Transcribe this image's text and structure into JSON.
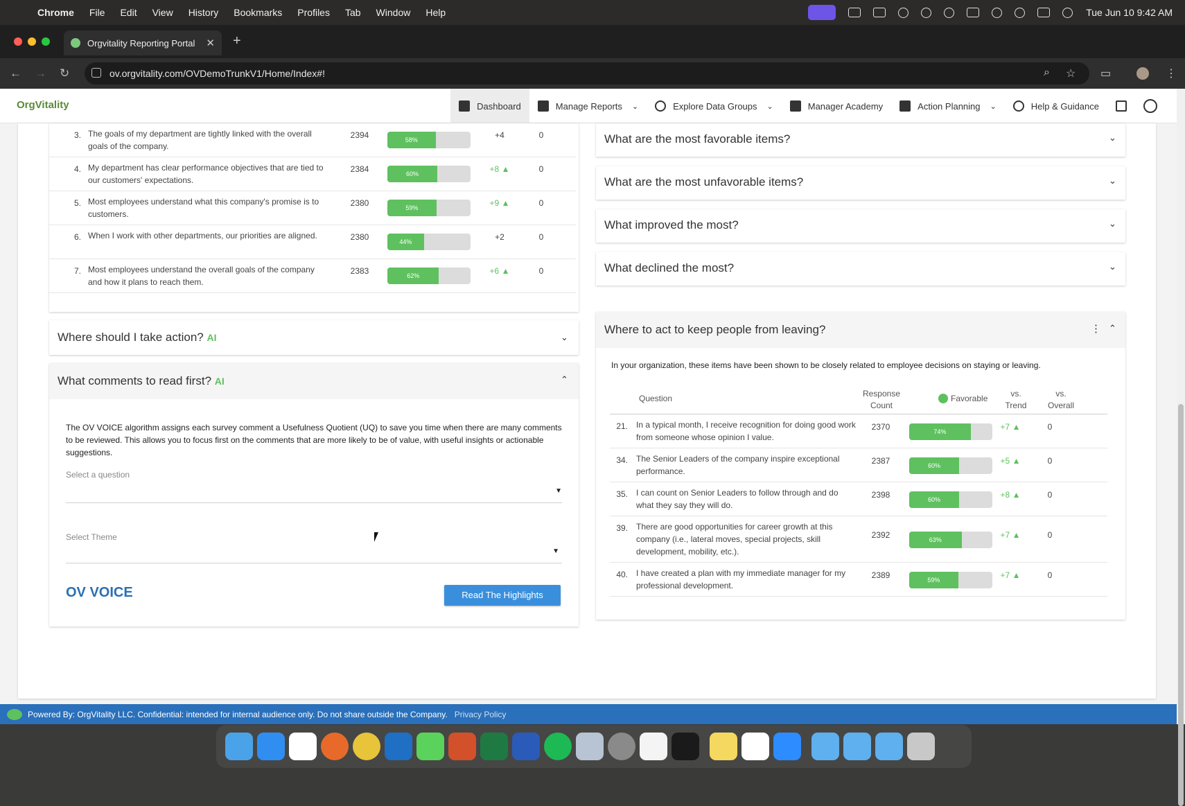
{
  "menubar": {
    "items": [
      "Chrome",
      "File",
      "Edit",
      "View",
      "History",
      "Bookmarks",
      "Profiles",
      "Tab",
      "Window",
      "Help"
    ],
    "datetime": "Tue Jun 10  9:42 AM"
  },
  "browser": {
    "tab_title": "Orgvitality Reporting Portal",
    "url": "ov.orgvitality.com/OVDemoTrunkV1/Home/Index#!"
  },
  "app": {
    "logo": "OrgVitality",
    "nav": {
      "dashboard": "Dashboard",
      "manage_reports": "Manage Reports",
      "explore_data_groups": "Explore Data Groups",
      "manager_academy": "Manager Academy",
      "action_planning": "Action Planning",
      "help_guidance": "Help & Guidance"
    }
  },
  "left_table": {
    "rows": [
      {
        "num": "3.",
        "question": "The goals of my department are tightly linked with the overall goals of the company.",
        "count": "2394",
        "favorable": 58,
        "fav_label": "58%",
        "trend": "+4",
        "trend_up": false,
        "overall": "0"
      },
      {
        "num": "4.",
        "question": "My department has clear performance objectives that are tied to our customers' expectations.",
        "count": "2384",
        "favorable": 60,
        "fav_label": "60%",
        "trend": "+8 ▲",
        "trend_up": true,
        "overall": "0"
      },
      {
        "num": "5.",
        "question": "Most employees understand what this company's promise is to customers.",
        "count": "2380",
        "favorable": 59,
        "fav_label": "59%",
        "trend": "+9 ▲",
        "trend_up": true,
        "overall": "0"
      },
      {
        "num": "6.",
        "question": "When I work with other departments, our priorities are aligned.",
        "count": "2380",
        "favorable": 44,
        "fav_label": "44%",
        "trend": "+2",
        "trend_up": false,
        "overall": "0"
      },
      {
        "num": "7.",
        "question": "Most employees understand the overall goals of the company and how it plans to reach them.",
        "count": "2383",
        "favorable": 62,
        "fav_label": "62%",
        "trend": "+6 ▲",
        "trend_up": true,
        "overall": "0"
      }
    ]
  },
  "action_section": {
    "title": "Where should I take action?",
    "ai": "AI"
  },
  "comments_section": {
    "title": "What comments to read first?",
    "ai": "AI",
    "intro": "The OV VOICE algorithm assigns each survey comment a Usefulness Quotient (UQ) to save you time when there are many comments to be reviewed. This allows you to focus first on the comments that are more likely to be of value, with useful insights or actionable suggestions.",
    "select_question": "Select a question",
    "select_theme": "Select Theme",
    "voice_logo": "OV VOICE",
    "read_button": "Read The Highlights"
  },
  "right_accordions": [
    "What are the most favorable items?",
    "What are the most unfavorable items?",
    "What improved the most?",
    "What declined the most?"
  ],
  "retention": {
    "title": "Where to act to keep people from leaving?",
    "intro": "In your organization, these items have been shown to be closely related to employee decisions on staying or leaving.",
    "headers": {
      "question": "Question",
      "response": "Response",
      "count": "Count",
      "favorable": "Favorable",
      "vs": "vs.",
      "trend": "Trend",
      "overall": "Overall"
    },
    "rows": [
      {
        "num": "21.",
        "question": "In a typical month, I receive recognition for doing good work from someone whose opinion I value.",
        "count": "2370",
        "favorable": 74,
        "fav_label": "74%",
        "trend": "+7 ▲",
        "overall": "0"
      },
      {
        "num": "34.",
        "question": "The Senior Leaders of the company inspire exceptional performance.",
        "count": "2387",
        "favorable": 60,
        "fav_label": "60%",
        "trend": "+5 ▲",
        "overall": "0"
      },
      {
        "num": "35.",
        "question": "I can count on Senior Leaders to follow through and do what they say they will do.",
        "count": "2398",
        "favorable": 60,
        "fav_label": "60%",
        "trend": "+8 ▲",
        "overall": "0"
      },
      {
        "num": "39.",
        "question": "There are good opportunities for career growth at this company (i.e., lateral moves, special projects, skill development, mobility, etc.).",
        "count": "2392",
        "favorable": 63,
        "fav_label": "63%",
        "trend": "+7 ▲",
        "overall": "0"
      },
      {
        "num": "40.",
        "question": "I have created a plan with my immediate manager for my professional development.",
        "count": "2389",
        "favorable": 59,
        "fav_label": "59%",
        "trend": "+7 ▲",
        "overall": "0"
      }
    ]
  },
  "footer": {
    "text": "Powered By: OrgVitality LLC.  Confidential: intended for internal audience only. Do not share outside the Company.",
    "privacy": "Privacy Policy"
  },
  "colors": {
    "accent_green": "#5fc05f",
    "button_blue": "#3a8fdc",
    "footer_blue": "#2a70bb"
  }
}
